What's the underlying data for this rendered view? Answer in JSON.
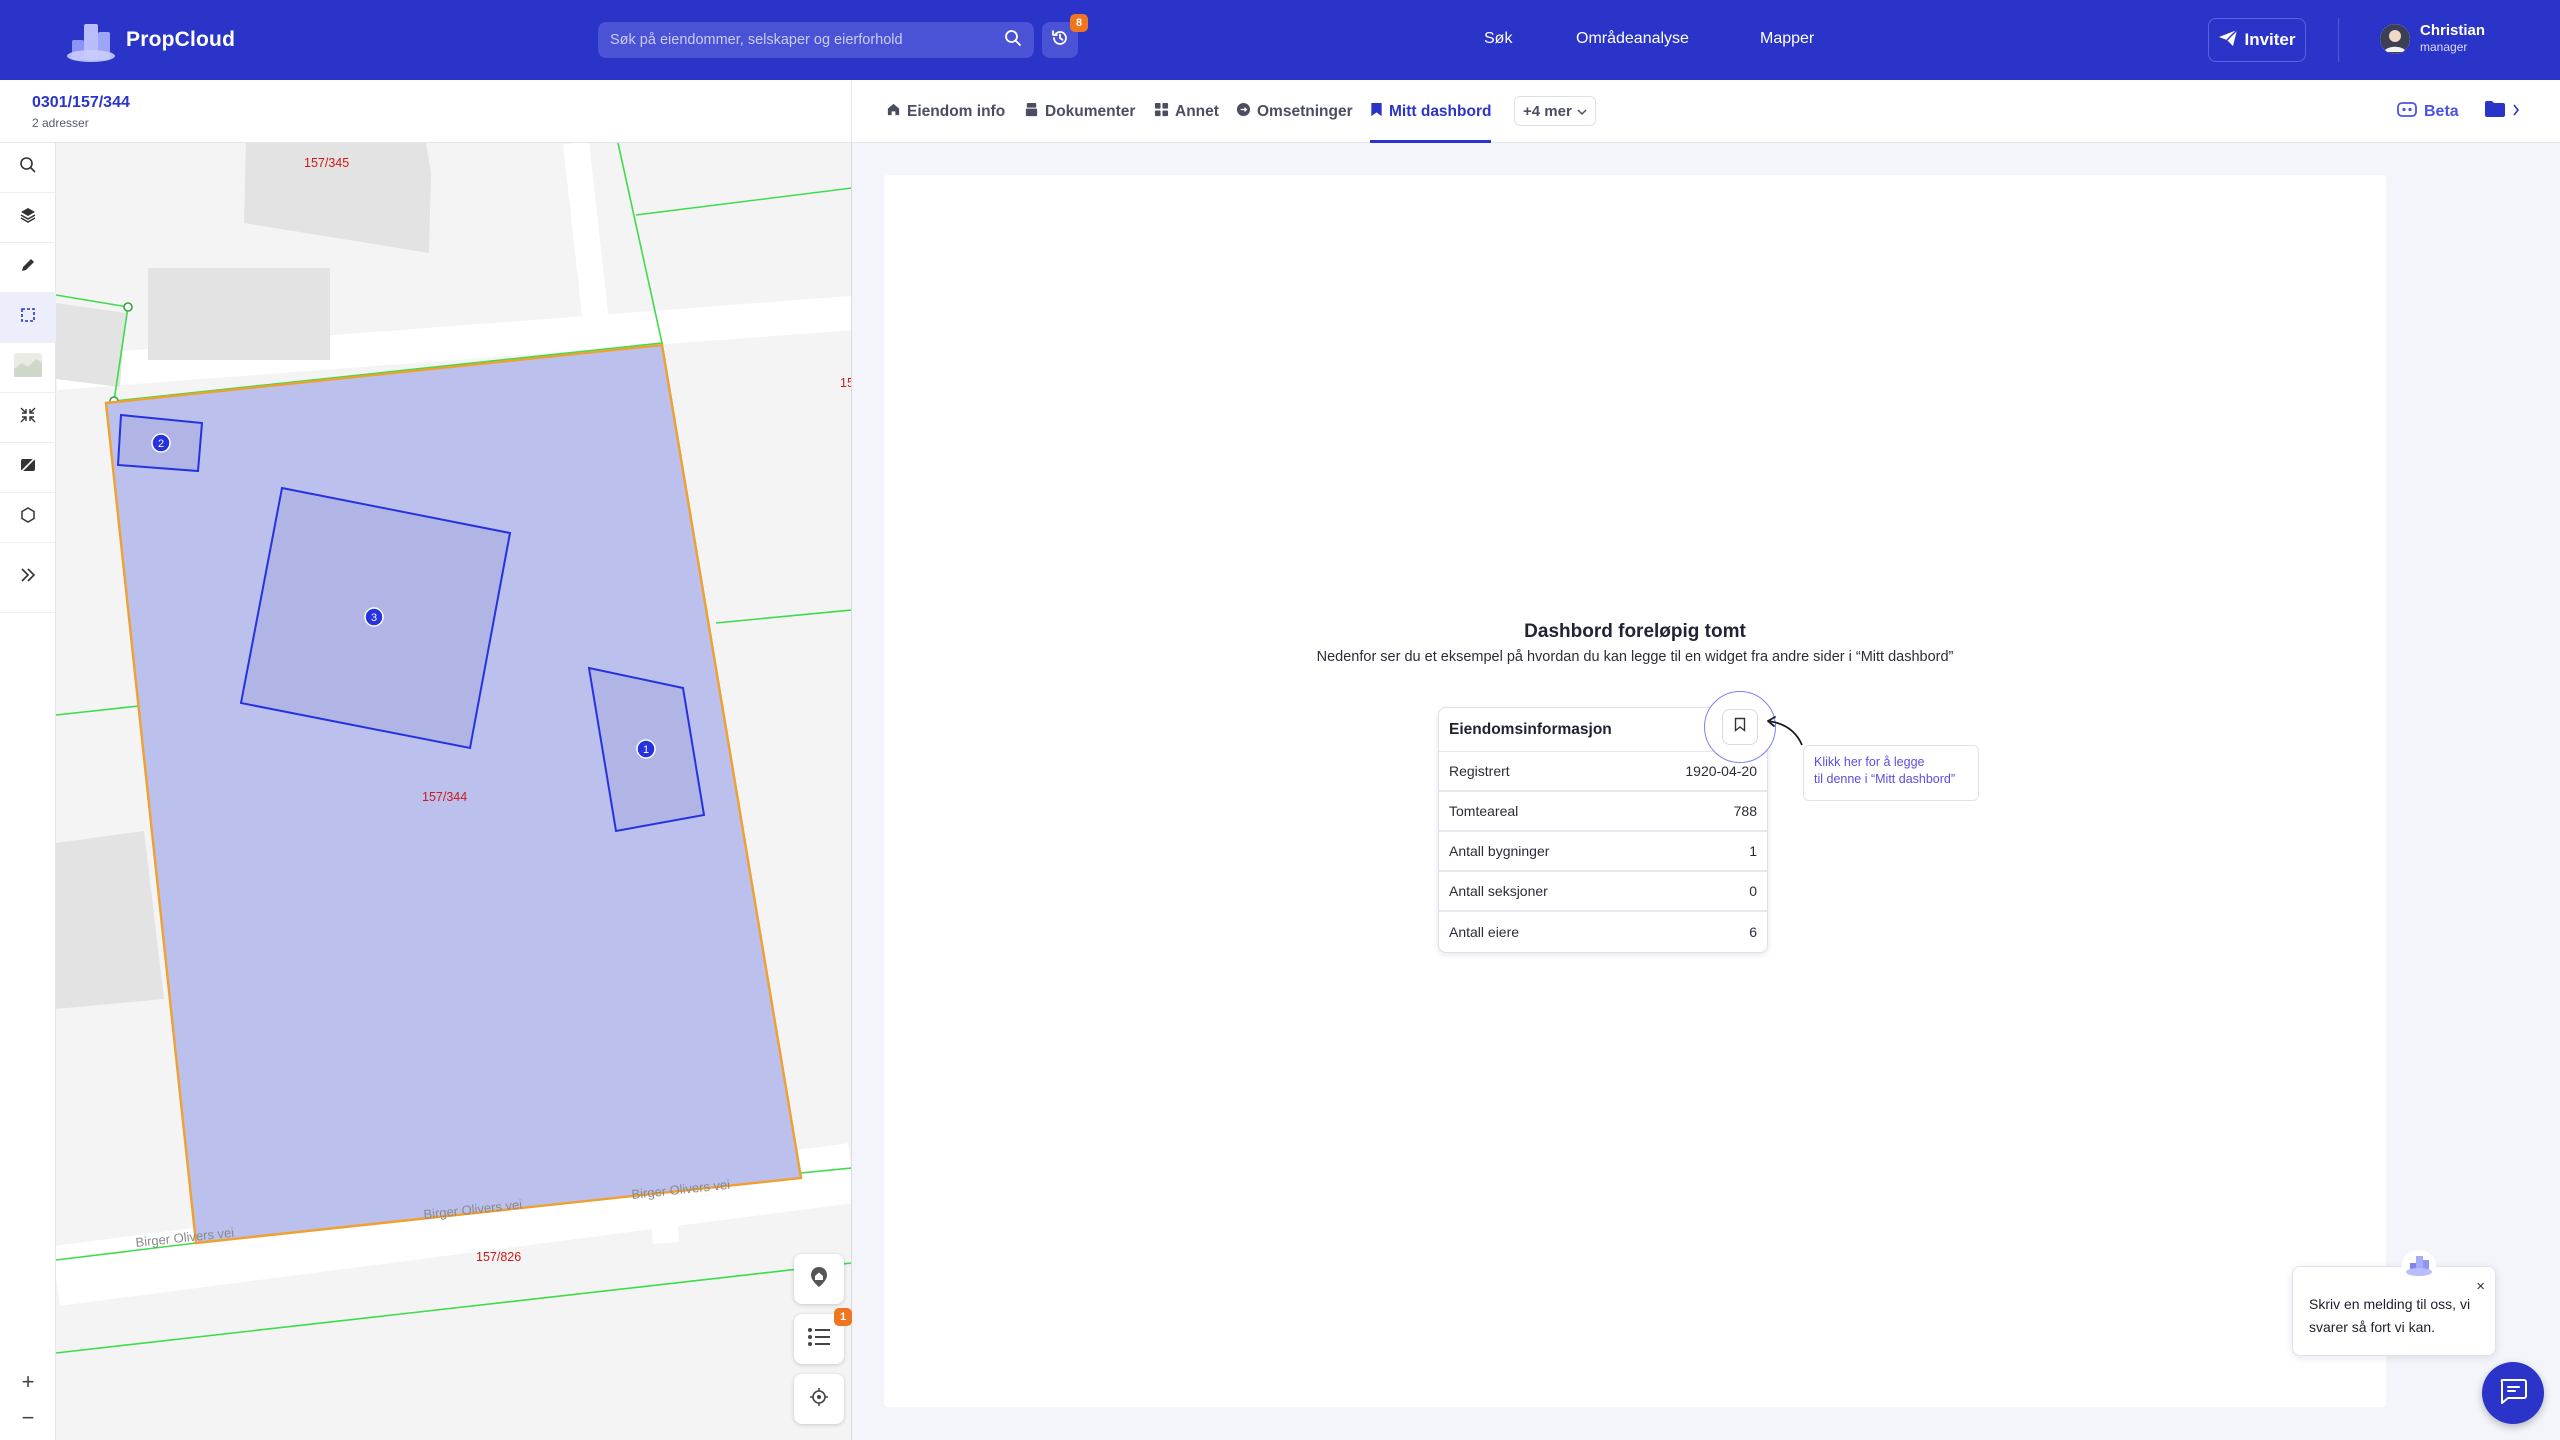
{
  "header": {
    "app_name": "PropCloud",
    "search_placeholder": "Søk på eiendommer, selskaper og eierforhold",
    "history_badge": "8",
    "nav": [
      "Søk",
      "Områdeanalyse",
      "Mapper"
    ],
    "invite_label": "Inviter",
    "user_name": "Christian",
    "user_role": "manager"
  },
  "property": {
    "id": "0301/157/344",
    "subtitle": "2 adresser"
  },
  "tabs": [
    {
      "label": "Eiendom info",
      "icon": "home-icon"
    },
    {
      "label": "Dokumenter",
      "icon": "document-stack-icon"
    },
    {
      "label": "Annet",
      "icon": "grid-icon"
    },
    {
      "label": "Omsetninger",
      "icon": "transaction-icon"
    },
    {
      "label": "Mitt dashbord",
      "icon": "bookmark-icon",
      "active": true
    }
  ],
  "tabs_more": "+4 mer",
  "beta_label": "Beta",
  "map": {
    "parcel_labels": [
      "157/345",
      "157/344",
      "157/826",
      "15"
    ],
    "street_labels": [
      "Birger Olivers vei",
      "Birger Olivers vei",
      "Birger Olivers vei"
    ],
    "building_markers": [
      "2",
      "3",
      "1"
    ],
    "list_badge": "1"
  },
  "dashboard": {
    "empty_title": "Dashbord foreløpig tomt",
    "empty_subtitle": "Nedenfor ser du et eksempel på hvordan du kan legge til en widget fra andre sider i “Mitt dashbord”",
    "widget_title": "Eiendomsinformasjon",
    "widget_rows": [
      {
        "label": "Registrert",
        "value": "1920-04-20"
      },
      {
        "label": "Tomteareal",
        "value": "788"
      },
      {
        "label": "Antall bygninger",
        "value": "1"
      },
      {
        "label": "Antall seksjoner",
        "value": "0"
      },
      {
        "label": "Antall eiere",
        "value": "6"
      }
    ],
    "hint_line1": "Klikk her for å legge",
    "hint_line2": "til denne i “Mitt dashbord”"
  },
  "chat": {
    "message": "Skriv en melding til oss, vi svarer så fort vi kan.",
    "close": "×"
  },
  "colors": {
    "brand": "#2b34c8",
    "parcel_fill": "#bcc0ec",
    "parcel_border": "#f0a030",
    "building_border": "#2631e0",
    "property_lines": "#3ddc4a",
    "badge": "#f0751f"
  }
}
